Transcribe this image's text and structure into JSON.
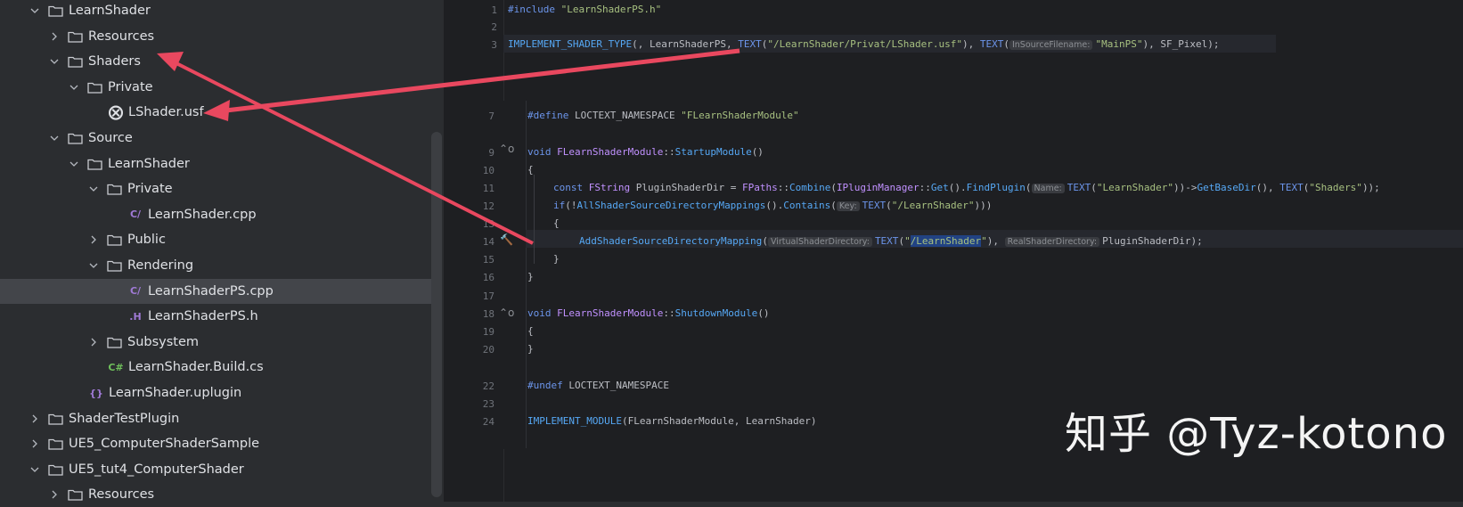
{
  "tree": {
    "rows": [
      {
        "label": "LearnShader",
        "type": "folder",
        "depth": 0,
        "expanded": true
      },
      {
        "label": "Resources",
        "type": "folder",
        "depth": 1,
        "expanded": false
      },
      {
        "label": "Shaders",
        "type": "folder",
        "depth": 1,
        "expanded": true
      },
      {
        "label": "Private",
        "type": "folder",
        "depth": 2,
        "expanded": true
      },
      {
        "label": "LShader.usf",
        "type": "usf-file",
        "depth": 3
      },
      {
        "label": "Source",
        "type": "folder",
        "depth": 1,
        "expanded": true
      },
      {
        "label": "LearnShader",
        "type": "folder",
        "depth": 2,
        "expanded": true
      },
      {
        "label": "Private",
        "type": "folder",
        "depth": 3,
        "expanded": true
      },
      {
        "label": "LearnShader.cpp",
        "type": "cpp-file",
        "depth": 4
      },
      {
        "label": "Public",
        "type": "folder",
        "depth": 3,
        "expanded": false
      },
      {
        "label": "Rendering",
        "type": "folder",
        "depth": 3,
        "expanded": true
      },
      {
        "label": "LearnShaderPS.cpp",
        "type": "cpp-file",
        "depth": 4,
        "selected": true
      },
      {
        "label": "LearnShaderPS.h",
        "type": "h-file",
        "depth": 4
      },
      {
        "label": "Subsystem",
        "type": "folder",
        "depth": 3,
        "expanded": false
      },
      {
        "label": "LearnShader.Build.cs",
        "type": "cs-file",
        "depth": 3
      },
      {
        "label": "LearnShader.uplugin",
        "type": "uplugin-file",
        "depth": 2
      },
      {
        "label": "ShaderTestPlugin",
        "type": "folder",
        "depth": 0,
        "expanded": false
      },
      {
        "label": "UE5_ComputerShaderSample",
        "type": "folder",
        "depth": 0,
        "expanded": false
      },
      {
        "label": "UE5_tut4_ComputerShader",
        "type": "folder",
        "depth": 0,
        "expanded": true
      },
      {
        "label": "Resources",
        "type": "folder",
        "depth": 1,
        "expanded": false
      }
    ]
  },
  "top_editor": {
    "line_numbers": [
      "1",
      "2",
      "3"
    ],
    "line1": {
      "directive": "#include",
      "str": "\"LearnShaderPS.h\""
    },
    "line3": {
      "macro": "IMPLEMENT_SHADER_TYPE",
      "p1": "(, LearnShaderPS, ",
      "text_kw": "TEXT",
      "path": "\"/LearnShader/Privat/LShader.usf\"",
      "p2": "), ",
      "text_kw2": "TEXT",
      "hint": "InSourceFilename:",
      "mainps": "\"MainPS\"",
      "p3": "), SF_Pixel);"
    }
  },
  "inset_editor": {
    "line_numbers": [
      "7",
      "9",
      "10",
      "11",
      "12",
      "13",
      "14",
      "15",
      "16",
      "17",
      "18",
      "19",
      "20",
      "22",
      "23",
      "24"
    ],
    "l7": {
      "directive": "#define",
      "rest": " LOCTEXT_NAMESPACE ",
      "str": "\"FLearnShaderModule\""
    },
    "l9": {
      "kw": "void",
      "cls": "FLearnShaderModule",
      "sep": "::",
      "fn": "StartupModule",
      "rest": "()"
    },
    "l10": "{",
    "l11": {
      "kw": "const",
      "ty": "FString",
      "var": " PluginShaderDir = ",
      "cls": "FPaths",
      "fn": "Combine",
      "mid": "(",
      "cls2": "IPluginManager",
      "fn2": "Get",
      "fn3": "FindPlugin",
      "hint": "Name:",
      "text": "TEXT",
      "str": "\"LearnShader\"",
      "arrow": "))->",
      "fn4": "GetBaseDir",
      "mid2": "(), ",
      "text2": "TEXT",
      "str2": "\"Shaders\"",
      "end": "));"
    },
    "l12": {
      "kw": "if",
      "p": "(!",
      "fn": "AllShaderSourceDirectoryMappings",
      "p2": "().",
      "fn2": "Contains",
      "hint": "Key:",
      "text": "TEXT",
      "str": "\"/LearnShader\"",
      "end": ")))"
    },
    "l13": "{",
    "l14": {
      "fn": "AddShaderSourceDirectoryMapping",
      "hint": "VirtualShaderDirectory:",
      "text": "TEXT",
      "q1": "\"",
      "sel": "/LearnShader",
      "q2": "\"",
      "hint2": "RealShaderDirectory:",
      "var": "PluginShaderDir",
      "end": ");"
    },
    "l15": "}",
    "l16": "}",
    "l18": {
      "kw": "void",
      "cls": "FLearnShaderModule",
      "sep": "::",
      "fn": "ShutdownModule",
      "rest": "()"
    },
    "l19": "{",
    "l20": "}",
    "l22": {
      "directive": "#undef",
      "rest": " LOCTEXT_NAMESPACE"
    },
    "l24": {
      "macro": "IMPLEMENT_MODULE",
      "rest": "(FLearnShaderModule, LearnShader)"
    }
  },
  "watermark": "知乎 @Tyz-kotono",
  "colors": {
    "arrow": "#e9485f",
    "bg": "#1e1f22",
    "sidebar": "#2b2d30"
  }
}
